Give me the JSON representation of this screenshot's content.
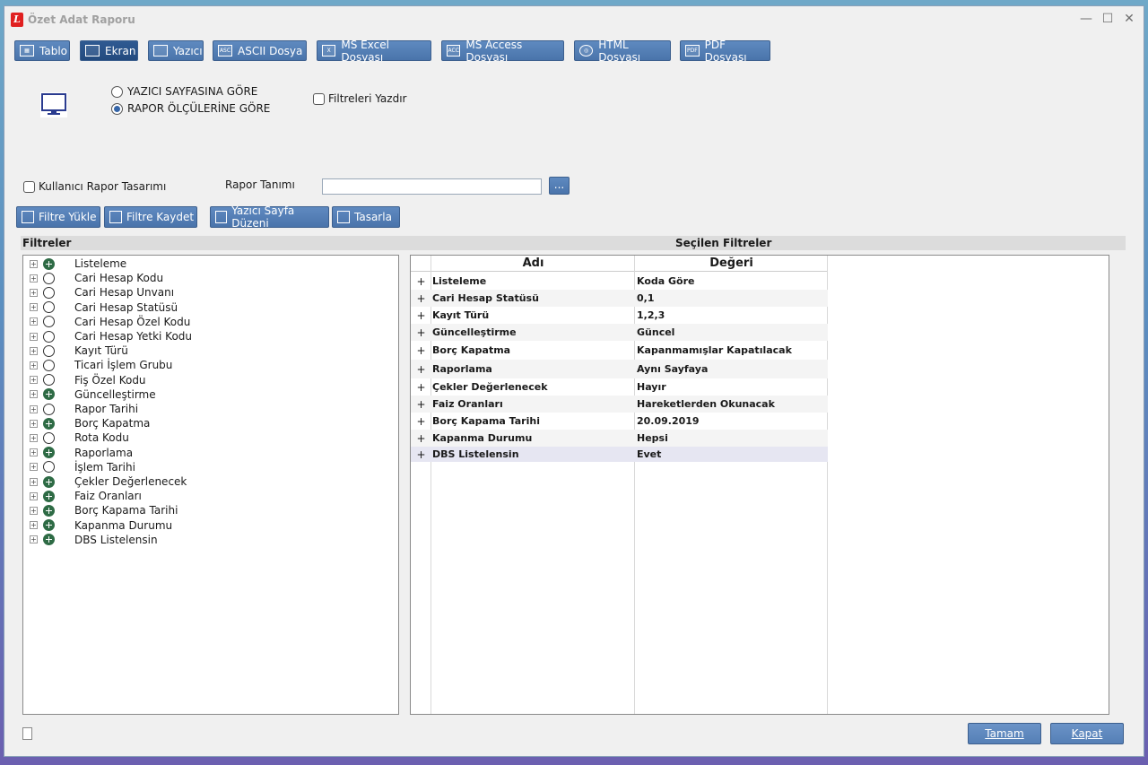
{
  "window": {
    "title": "Özet Adat Raporu"
  },
  "toolbar": [
    {
      "label": "Tablo",
      "icon": "table-icon"
    },
    {
      "label": "Ekran",
      "icon": "monitor-icon"
    },
    {
      "label": "Yazıcı",
      "icon": "printer-icon"
    },
    {
      "label": "ASCII Dosya",
      "icon": "ascii-file-icon"
    },
    {
      "label": "MS Excel Dosyası",
      "icon": "excel-file-icon"
    },
    {
      "label": "MS Access Dosyası",
      "icon": "access-file-icon"
    },
    {
      "label": "HTML Dosyası",
      "icon": "globe-icon"
    },
    {
      "label": "PDF Dosyası",
      "icon": "pdf-file-icon"
    }
  ],
  "options": {
    "radio1": "YAZICI SAYFASINA GÖRE",
    "radio2": "RAPOR ÖLÇÜLERİNE GÖRE",
    "print_filters": "Filtreleri Yazdır",
    "user_design": "Kullanıcı Rapor Tasarımı",
    "report_def_label": "Rapor Tanımı",
    "report_def_value": "",
    "browse": "..."
  },
  "actions": {
    "load": "Filtre Yükle",
    "save": "Filtre Kaydet",
    "page_setup": "Yazıcı Sayfa Düzeni",
    "design": "Tasarla"
  },
  "sections": {
    "filters": "Filtreler",
    "selected": "Seçilen Filtreler"
  },
  "tree": [
    {
      "label": "Listeleme",
      "selected": true
    },
    {
      "label": "Cari Hesap Kodu",
      "selected": false
    },
    {
      "label": "Cari Hesap Unvanı",
      "selected": false
    },
    {
      "label": "Cari Hesap Statüsü",
      "selected": false
    },
    {
      "label": "Cari Hesap Özel Kodu",
      "selected": false
    },
    {
      "label": "Cari Hesap Yetki Kodu",
      "selected": false
    },
    {
      "label": "Kayıt Türü",
      "selected": false
    },
    {
      "label": "Ticari İşlem Grubu",
      "selected": false
    },
    {
      "label": "Fiş Özel Kodu",
      "selected": false
    },
    {
      "label": "Güncelleştirme",
      "selected": true
    },
    {
      "label": "Rapor Tarihi",
      "selected": false
    },
    {
      "label": "Borç Kapatma",
      "selected": true
    },
    {
      "label": "Rota Kodu",
      "selected": false
    },
    {
      "label": "Raporlama",
      "selected": true
    },
    {
      "label": "İşlem Tarihi",
      "selected": false
    },
    {
      "label": "Çekler Değerlenecek",
      "selected": true
    },
    {
      "label": "Faiz Oranları",
      "selected": true
    },
    {
      "label": "Borç Kapama Tarihi",
      "selected": true
    },
    {
      "label": "Kapanma Durumu",
      "selected": true
    },
    {
      "label": "DBS Listelensin",
      "selected": true
    }
  ],
  "grid": {
    "headers": {
      "name": "Adı",
      "value": "Değeri"
    },
    "rows": [
      {
        "name": "Listeleme",
        "value": "Koda Göre"
      },
      {
        "name": "Cari Hesap Statüsü",
        "value": "0,1"
      },
      {
        "name": "Kayıt Türü",
        "value": "1,2,3"
      },
      {
        "name": "Güncelleştirme",
        "value": "Güncel"
      },
      {
        "name": "Borç Kapatma",
        "value": "Kapanmamışlar Kapatılacak"
      },
      {
        "name": "Raporlama",
        "value": "Aynı Sayfaya"
      },
      {
        "name": "Çekler Değerlenecek",
        "value": "Hayır"
      },
      {
        "name": "Faiz Oranları",
        "value": "Hareketlerden Okunacak"
      },
      {
        "name": "Borç Kapama Tarihi",
        "value": "20.09.2019"
      },
      {
        "name": "Kapanma Durumu",
        "value": "Hepsi"
      },
      {
        "name": "DBS Listelensin",
        "value": "Evet"
      }
    ]
  },
  "footer": {
    "ok": "Tamam",
    "close": "Kapat"
  }
}
